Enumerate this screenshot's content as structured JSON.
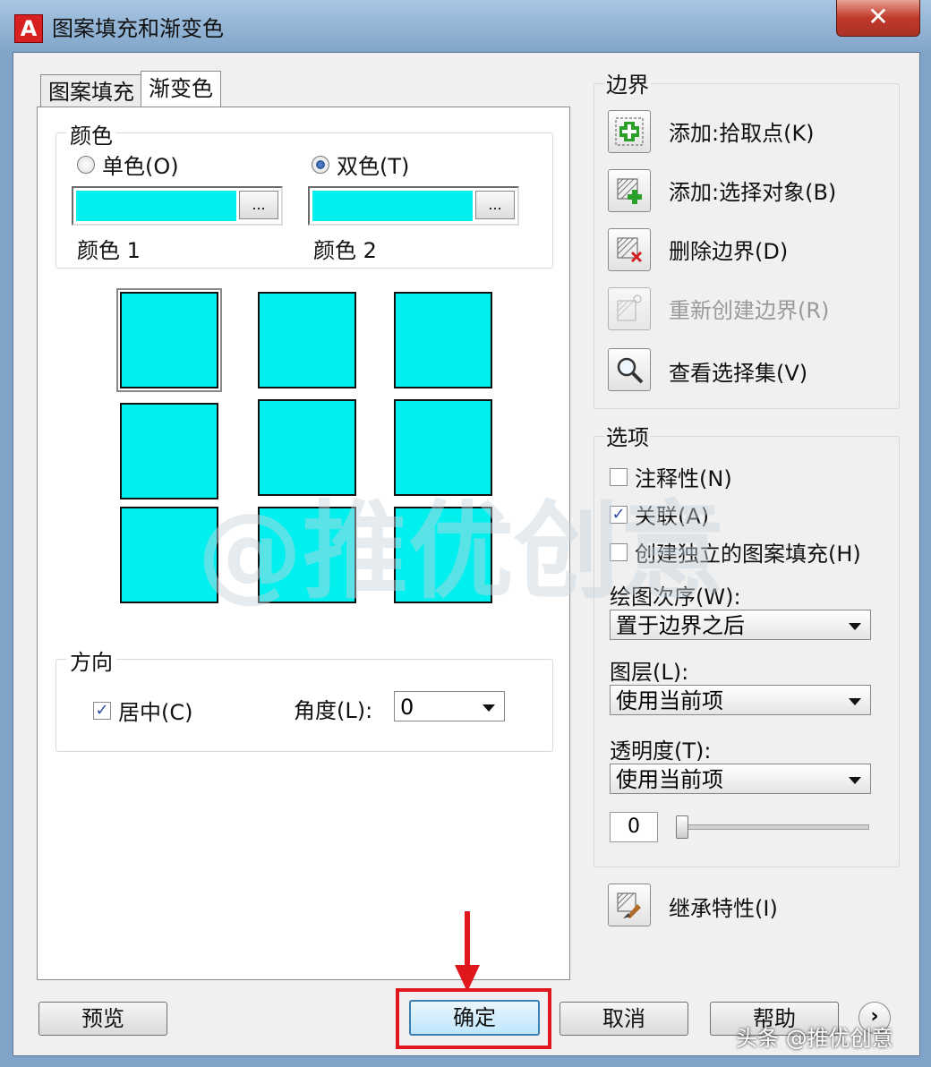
{
  "window": {
    "title": "图案填充和渐变色",
    "app_icon": "A",
    "close": "✕"
  },
  "tabs": [
    {
      "label": "图案填充"
    },
    {
      "label": "渐变色"
    }
  ],
  "gradient": {
    "color_group_label": "颜色",
    "one_color": "单色(O)",
    "two_color": "双色(T)",
    "mode": "two_color",
    "color1_label": "颜色 1",
    "color2_label": "颜色 2",
    "color1": "#00f0f0",
    "color2": "#00f0f0",
    "dots": "...",
    "swatch_count": 9,
    "selected_swatch": 0
  },
  "orientation": {
    "group_label": "方向",
    "centered_label": "居中(C)",
    "centered_checked": true,
    "angle_label": "角度(L):",
    "angle_value": "0"
  },
  "boundaries": {
    "group_label": "边界",
    "add_pick_points": "添加:拾取点(K)",
    "add_select_objects": "添加:选择对象(B)",
    "remove_boundaries": "删除边界(D)",
    "recreate_boundary": "重新创建边界(R)",
    "view_selections": "查看选择集(V)"
  },
  "options": {
    "group_label": "选项",
    "annotative": "注释性(N)",
    "annotative_checked": false,
    "associative": "关联(A)",
    "associative_checked": true,
    "separate_hatches": "创建独立的图案填充(H)",
    "separate_checked": false,
    "draw_order_label": "绘图次序(W):",
    "draw_order_value": "置于边界之后",
    "layer_label": "图层(L):",
    "layer_value": "使用当前项",
    "transparency_label": "透明度(T):",
    "transparency_value": "使用当前项",
    "transparency_number": "0",
    "transparency_level": 0
  },
  "inherit_properties": "继承特性(I)",
  "footer": {
    "preview": "预览",
    "ok": "确定",
    "cancel": "取消",
    "help": "帮助",
    "more": "›"
  },
  "watermark": "@推优创意",
  "corner_mark": "头条 @推优创意"
}
